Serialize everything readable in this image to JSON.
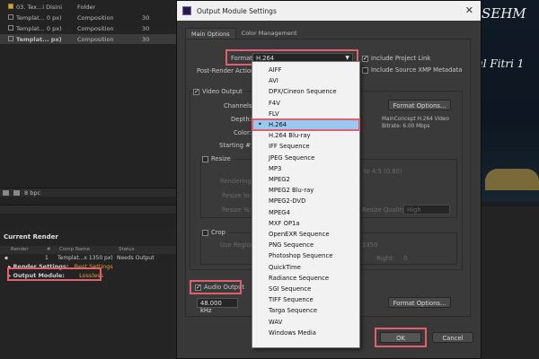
{
  "project": {
    "rows": [
      {
        "name": "03. Tex...i Disini",
        "type": "Folder",
        "frame": ""
      },
      {
        "name": "Templat... 0 px)",
        "type": "Composition",
        "frame": "30"
      },
      {
        "name": "Templat... 0 px)",
        "type": "Composition",
        "frame": "30"
      },
      {
        "name": "Templat... px)",
        "type": "Composition",
        "frame": "30"
      }
    ],
    "bpc": "8 bpc"
  },
  "render_queue": {
    "title": "Current Render",
    "headers": {
      "render": "Render",
      "hash": "#",
      "comp": "Comp Name",
      "status": "Status"
    },
    "item": {
      "index": "1",
      "comp": "Templat...x 1350 px)",
      "status": "Needs Output"
    },
    "render_settings_label": "Render Settings:",
    "render_settings_value": "Best Settings",
    "output_module_label": "Output Module:",
    "output_module_value": "Lossless"
  },
  "dialog": {
    "title": "Output Module Settings",
    "close": "✕",
    "tabs": [
      "Main Options",
      "Color Management"
    ],
    "format_label": "Format:",
    "format_value": "H.264",
    "include_project_link": "Include Project Link",
    "post_render_label": "Post-Render Action:",
    "include_xmp": "Include Source XMP Metadata",
    "video_output": "Video Output",
    "channels_label": "Channels:",
    "depth_label": "Depth:",
    "color_label": "Color:",
    "starting_label": "Starting #:",
    "format_options": "Format Options...",
    "info_line1": "MainConcept H.264 Video",
    "info_line2": "Bitrate: 6.00 Mbps",
    "resize": "Resize",
    "rendering_at": "Rendering at:",
    "resize_to": "Resize to:",
    "resize_pct": "Resize %:",
    "to_ratio": "to 4:5 (0.80)",
    "resize_quality": "Resize Quality:",
    "resize_quality_value": "High",
    "crop": "Crop",
    "use_region": "Use Region",
    "crop_value": "1350",
    "right_label": "Right:",
    "right_value": "0",
    "audio_output": "Audio Output",
    "sample_rate": "48.000 kHz",
    "audio_format_options": "Format Options...",
    "ok": "OK",
    "cancel": "Cancel"
  },
  "format_list": {
    "items": [
      "AIFF",
      "AVI",
      "DPX/Cineon Sequence",
      "F4V",
      "FLV",
      "H.264",
      "H.264 Blu-ray",
      "IFF Sequence",
      "JPEG Sequence",
      "MP3",
      "MPEG2",
      "MPEG2 Blu-ray",
      "MPEG2-DVD",
      "MPEG4",
      "MXF OP1a",
      "OpenEXR Sequence",
      "PNG Sequence",
      "Photoshop Sequence",
      "QuickTime",
      "Radiance Sequence",
      "SGI Sequence",
      "TIFF Sequence",
      "Targa Sequence",
      "WAV",
      "Windows Media"
    ],
    "selected": "H.264",
    "selected_marker": "•"
  },
  "preview_art": {
    "line1": "SEHM",
    "line2": "ul Fitri 1"
  },
  "colors": {
    "highlight": "#e06070",
    "selected_item": "#99c9f0",
    "link": "#e0a030"
  }
}
